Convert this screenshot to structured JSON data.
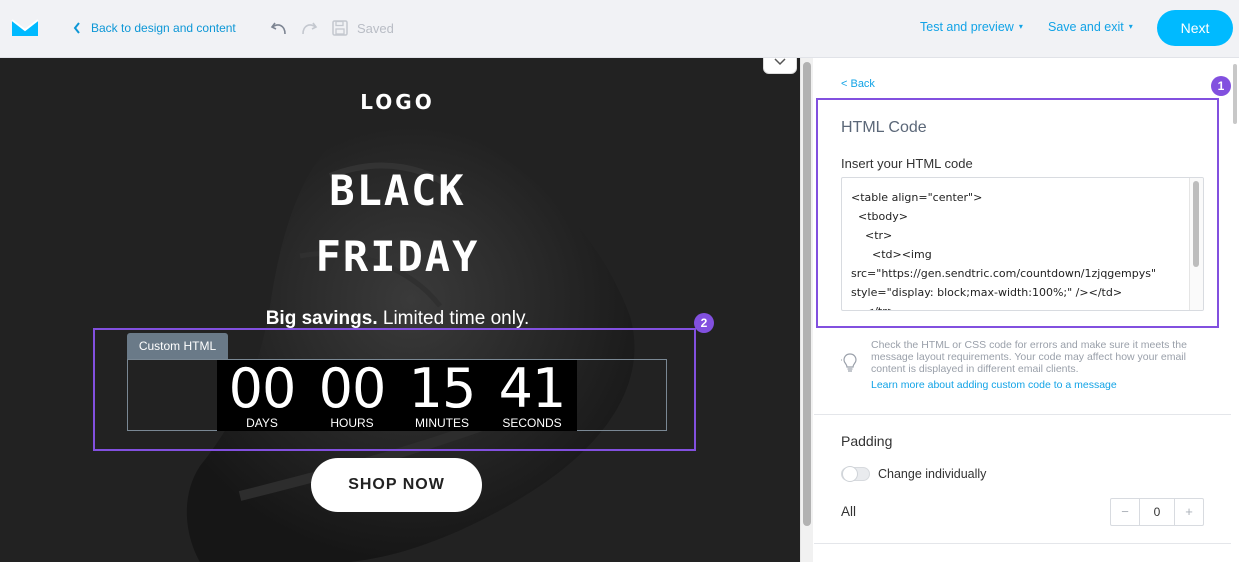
{
  "header": {
    "back_label": "Back to design and content",
    "saved_label": "Saved",
    "test_preview_label": "Test and preview",
    "save_exit_label": "Save and exit",
    "next_label": "Next",
    "dropdown_caret": "▾"
  },
  "canvas": {
    "email_logo": "LOGO",
    "headline_1": "BLACK",
    "headline_2": "FRIDAY",
    "tagline_bold": "Big savings.",
    "tagline_rest": " Limited time only.",
    "custom_html_tag": "Custom HTML",
    "countdown": [
      {
        "value": "00",
        "label": "DAYS"
      },
      {
        "value": "00",
        "label": "HOURS"
      },
      {
        "value": "15",
        "label": "MINUTES"
      },
      {
        "value": "41",
        "label": "SECONDS"
      }
    ],
    "shop_button": "SHOP NOW",
    "badge_block": "2"
  },
  "panel": {
    "back_label": "< Back",
    "badge_code": "1",
    "title": "HTML Code",
    "subtitle": "Insert your HTML code",
    "code": "<table align=\"center\">\n  <tbody>\n    <tr>\n      <td><img src=\"https://gen.sendtric.com/countdown/1zjqgempys\" style=\"display: block;max-width:100%;\" /></td>\n    </tr>",
    "hint_text": "Check the HTML or CSS code for errors and make sure it meets the message layout requirements. Your code may affect how your email content is displayed in different email clients.",
    "hint_link": "Learn more about adding custom code to a message",
    "padding_title": "Padding",
    "toggle_label": "Change individually",
    "all_label": "All",
    "padding_value": "0",
    "minus": "−",
    "plus": "+"
  },
  "colors": {
    "accent": "#00baff",
    "link": "#12a3e6",
    "highlight": "#8250df",
    "canvas_bg": "#222222"
  },
  "icons": [
    "envelope-logo-icon",
    "chevron-left-icon",
    "undo-icon",
    "redo-icon",
    "save-icon",
    "chevron-down-icon",
    "lightbulb-icon"
  ]
}
